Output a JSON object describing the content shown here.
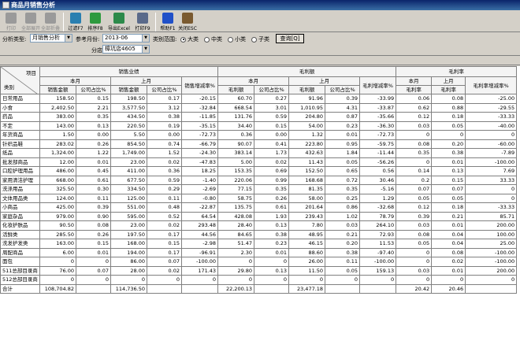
{
  "window": {
    "title": "商品月销售分析"
  },
  "toolbar": [
    {
      "label": "打印",
      "icon": "print-icon",
      "enabled": false
    },
    {
      "label": "全部展开",
      "icon": "expand-icon",
      "enabled": false
    },
    {
      "label": "全部折叠",
      "icon": "collapse-icon",
      "enabled": false
    },
    {
      "label": "过滤F7",
      "icon": "filter-icon",
      "enabled": true
    },
    {
      "label": "排序F8",
      "icon": "sort-icon",
      "enabled": true
    },
    {
      "label": "导出Excel",
      "icon": "excel-icon",
      "enabled": true
    },
    {
      "label": "打印F9",
      "icon": "printer-icon",
      "enabled": true
    },
    {
      "label": "帮助F1",
      "icon": "help-icon",
      "enabled": true
    },
    {
      "label": "关闭ESC",
      "icon": "close-door-icon",
      "enabled": true
    }
  ],
  "filters": {
    "analysis_type_label": "分析类型:",
    "analysis_type_value": "月销售分析",
    "month_label": "参考月份:",
    "month_value": "2013-06",
    "range_label": "类别范围:",
    "ranges": [
      {
        "label": "大类",
        "selected": true
      },
      {
        "label": "中类",
        "selected": false
      },
      {
        "label": "小类",
        "selected": false
      },
      {
        "label": "子类",
        "selected": false
      }
    ],
    "query_button": "查询[Q]",
    "store_label": "分店:",
    "store_value": "樟坑店4605"
  },
  "table": {
    "corner_top": "项目",
    "corner_bottom": "类别",
    "groups": [
      "销售业绩",
      "毛利额",
      "毛利率"
    ],
    "subgroups": [
      "本月",
      "上月",
      "本月",
      "上月",
      "本月",
      "上月"
    ],
    "growth_headers": [
      "销售增减率%",
      "毛利增减率%",
      "毛利率增减率%"
    ],
    "leaf_headers": [
      "销售金额",
      "公司占比%",
      "销售金额",
      "公司占比%",
      "毛利额",
      "公司占比%",
      "毛利额",
      "公司占比%",
      "毛利率",
      "毛利率"
    ],
    "rows": [
      [
        "日常用品",
        "158.50",
        "0.15",
        "198.50",
        "0.17",
        "-20.15",
        "60.70",
        "0.27",
        "91.96",
        "0.39",
        "-33.99",
        "0.06",
        "0.08",
        "-25.00"
      ],
      [
        "小食",
        "2,402.50",
        "2.21",
        "3,577.50",
        "3.12",
        "-32.84",
        "668.54",
        "3.01",
        "1,010.95",
        "4.31",
        "-33.87",
        "0.62",
        "0.88",
        "-29.55"
      ],
      [
        "药品",
        "383.00",
        "0.35",
        "434.50",
        "0.38",
        "-11.85",
        "131.76",
        "0.59",
        "204.80",
        "0.87",
        "-35.66",
        "0.12",
        "0.18",
        "-33.33"
      ],
      [
        "不定",
        "143.00",
        "0.13",
        "220.50",
        "0.19",
        "-35.15",
        "34.40",
        "0.15",
        "54.00",
        "0.23",
        "-36.30",
        "0.03",
        "0.05",
        "-40.00"
      ],
      [
        "年货商品",
        "1.50",
        "0.00",
        "5.50",
        "0.00",
        "-72.73",
        "0.36",
        "0.00",
        "1.32",
        "0.01",
        "-72.73",
        "0",
        "0",
        "0"
      ],
      [
        "针织品鞋",
        "283.02",
        "0.26",
        "854.50",
        "0.74",
        "-66.79",
        "90.07",
        "0.41",
        "223.80",
        "0.95",
        "-59.75",
        "0.08",
        "0.20",
        "-60.00"
      ],
      [
        "纸品",
        "1,324.00",
        "1.22",
        "1,749.00",
        "1.52",
        "-24.30",
        "383.14",
        "1.73",
        "432.63",
        "1.84",
        "-11.44",
        "0.35",
        "0.38",
        "-7.89"
      ],
      [
        "批发部商品",
        "12.00",
        "0.01",
        "23.00",
        "0.02",
        "-47.83",
        "5.00",
        "0.02",
        "11.43",
        "0.05",
        "-56.26",
        "0",
        "0.01",
        "-100.00"
      ],
      [
        "口腔护理用品",
        "486.00",
        "0.45",
        "411.00",
        "0.36",
        "18.25",
        "153.35",
        "0.69",
        "152.50",
        "0.65",
        "0.56",
        "0.14",
        "0.13",
        "7.69"
      ],
      [
        "家用清洁护理",
        "668.00",
        "0.61",
        "677.50",
        "0.59",
        "-1.40",
        "220.06",
        "0.99",
        "168.68",
        "0.72",
        "30.46",
        "0.2",
        "0.15",
        "33.33"
      ],
      [
        "洗涤用品",
        "325.50",
        "0.30",
        "334.50",
        "0.29",
        "-2.69",
        "77.15",
        "0.35",
        "81.35",
        "0.35",
        "-5.16",
        "0.07",
        "0.07",
        "0"
      ],
      [
        "文体用品类",
        "124.00",
        "0.11",
        "125.00",
        "0.11",
        "-0.80",
        "58.75",
        "0.26",
        "58.00",
        "0.25",
        "1.29",
        "0.05",
        "0.05",
        "0"
      ],
      [
        "小商品",
        "425.00",
        "0.39",
        "551.00",
        "0.48",
        "-22.87",
        "135.75",
        "0.61",
        "201.64",
        "0.86",
        "-32.68",
        "0.12",
        "0.18",
        "-33.33"
      ],
      [
        "家庭杂品",
        "979.00",
        "0.90",
        "595.00",
        "0.52",
        "64.54",
        "428.08",
        "1.93",
        "239.43",
        "1.02",
        "78.79",
        "0.39",
        "0.21",
        "85.71"
      ],
      [
        "化妆护肤品",
        "90.50",
        "0.08",
        "23.00",
        "0.02",
        "293.48",
        "28.40",
        "0.13",
        "7.80",
        "0.03",
        "264.10",
        "0.03",
        "0.01",
        "200.00"
      ],
      [
        "活鲜类",
        "285.50",
        "0.26",
        "197.50",
        "0.17",
        "44.56",
        "84.65",
        "0.38",
        "48.95",
        "0.21",
        "72.93",
        "0.08",
        "0.04",
        "100.00"
      ],
      [
        "洗发护发类",
        "163.00",
        "0.15",
        "168.00",
        "0.15",
        "-2.98",
        "51.47",
        "0.23",
        "46.15",
        "0.20",
        "11.53",
        "0.05",
        "0.04",
        "25.00"
      ],
      [
        "周配商品",
        "6.00",
        "0.01",
        "194.00",
        "0.17",
        "-96.91",
        "2.30",
        "0.01",
        "88.60",
        "0.38",
        "-97.40",
        "0",
        "0.08",
        "-100.00"
      ],
      [
        "面包",
        "0",
        "0",
        "86.00",
        "0.07",
        "-100.00",
        "0",
        "0",
        "26.00",
        "0.11",
        "-100.00",
        "0",
        "0.02",
        "-100.00"
      ],
      [
        "511总部目录商",
        "76.00",
        "0.07",
        "28.00",
        "0.02",
        "171.43",
        "29.80",
        "0.13",
        "11.50",
        "0.05",
        "159.13",
        "0.03",
        "0.01",
        "200.00"
      ],
      [
        "512总部目录商",
        "0",
        "0",
        "0",
        "0",
        "0",
        "0",
        "0",
        "0",
        "0",
        "0",
        "0",
        "0",
        "0"
      ]
    ],
    "total_row": [
      "合计",
      "108,704.82",
      "",
      "114,736.50",
      "",
      "",
      "22,200.13",
      "",
      "23,477.18",
      "",
      "",
      "20.42",
      "20.46",
      ""
    ]
  }
}
